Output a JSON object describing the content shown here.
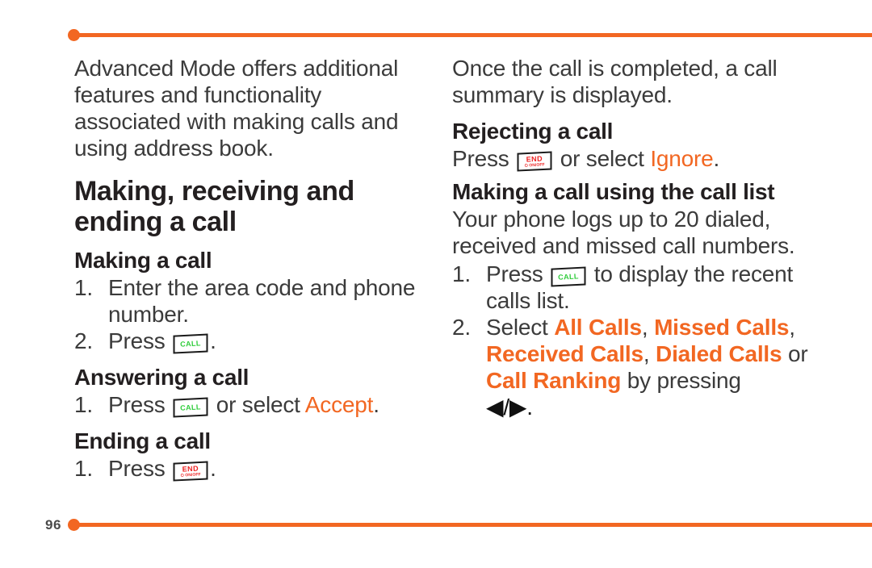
{
  "colors": {
    "accent": "#F26722",
    "text": "#3b3b3b",
    "heading": "#231f20",
    "call_green": "#2ecc3a",
    "end_red": "#ee2222"
  },
  "footer": {
    "page_number": "96"
  },
  "left_column": {
    "intro": "Advanced Mode offers additional features and functionality associated with making calls and using address book.",
    "title": "Making, receiving and ending a call",
    "sections": [
      {
        "heading": "Making a call",
        "steps": [
          {
            "num": "1.",
            "text_before": "Enter the area code and phone number.",
            "key": null,
            "text_after": ""
          },
          {
            "num": "2.",
            "text_before": "Press ",
            "key": "call-key",
            "text_after": "."
          }
        ]
      },
      {
        "heading": "Answering a call",
        "steps": [
          {
            "num": "1.",
            "text_before": "Press ",
            "key": "call-key",
            "text_mid": " or select ",
            "highlight": "Accept",
            "text_after": "."
          }
        ]
      },
      {
        "heading": "Ending a call",
        "steps": [
          {
            "num": "1.",
            "text_before": "Press ",
            "key": "end-key",
            "text_after": "."
          }
        ]
      }
    ]
  },
  "right_column": {
    "intro": "Once the call is completed, a call summary is displayed.",
    "sections": [
      {
        "heading": "Rejecting a call",
        "line_before": "Press ",
        "key": "end-key",
        "line_mid": " or select ",
        "highlight": "Ignore",
        "line_after": "."
      },
      {
        "heading": "Making a call using the call list",
        "body": "Your phone logs up to 20 dialed, received and missed call numbers.",
        "steps": [
          {
            "num": "1.",
            "text_before": "Press ",
            "key": "call-key",
            "text_after": " to display the recent calls list."
          },
          {
            "num": "2.",
            "text_before": "Select ",
            "options": [
              "All Calls",
              "Missed Calls",
              "Received Calls",
              "Dialed Calls",
              "Call Ranking"
            ],
            "separator": ", ",
            "conjunction": " or ",
            "text_after": " by pressing ",
            "arrows": "◀/▶."
          }
        ]
      }
    ]
  },
  "keys": {
    "call": {
      "label": "CALL",
      "sublabel": ""
    },
    "end": {
      "label": "END",
      "sublabel": "⏻ ON/OFF"
    }
  }
}
